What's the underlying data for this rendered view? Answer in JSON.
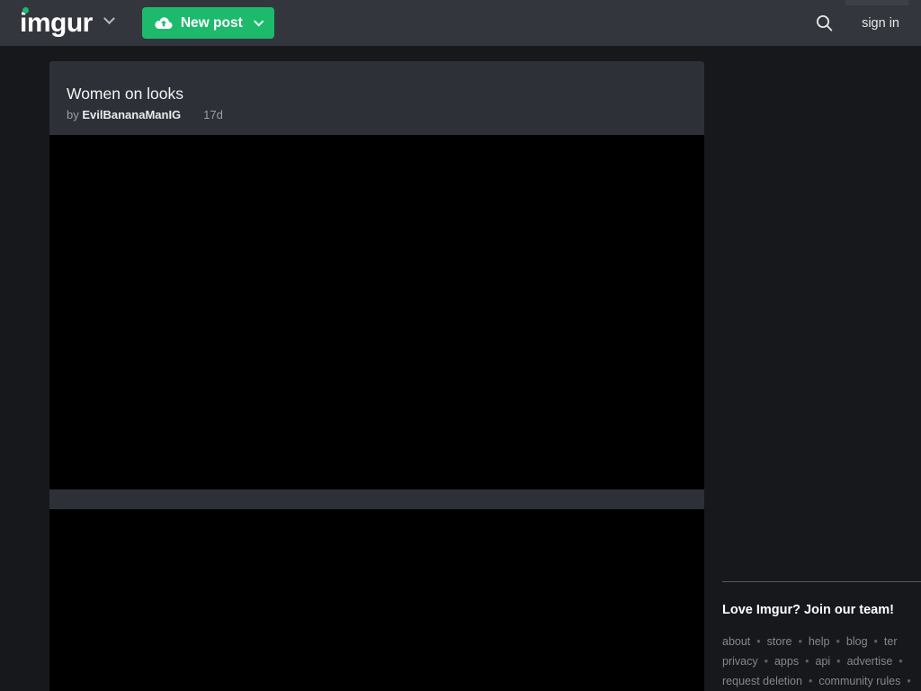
{
  "header": {
    "logo_text": "imgur",
    "logo_dropdown_icon": "chevron-down-icon",
    "new_post_label": "New post",
    "new_post_icon": "cloud-upload-icon",
    "new_post_dropdown_icon": "chevron-down-icon",
    "search_icon": "search-icon",
    "sign_in_label": "sign in",
    "accent_color": "#1dba6c",
    "bar_color": "#33373d"
  },
  "post": {
    "title": "Women on looks",
    "by_prefix": "by",
    "author": "EvilBananaManIG",
    "age": "17d",
    "header_bg": "#2d3137",
    "media_bg": "#000000"
  },
  "footer": {
    "heading": "Love Imgur? Join our team!",
    "rows": [
      [
        "about",
        "store",
        "help",
        "blog",
        "ter"
      ],
      [
        "privacy",
        "apps",
        "api",
        "advertise",
        ""
      ],
      [
        "request deletion",
        "community rules",
        ""
      ]
    ],
    "separator": "•",
    "link_color": "#83878d"
  },
  "page": {
    "background": "#17181c"
  }
}
